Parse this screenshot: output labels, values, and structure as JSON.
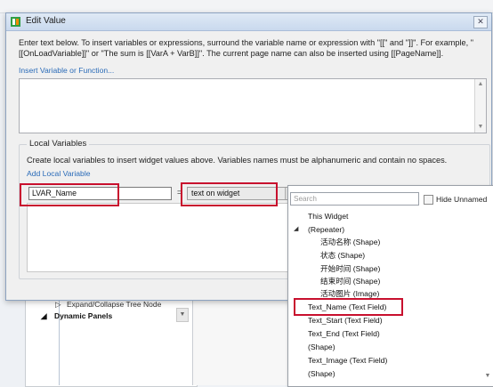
{
  "dialog": {
    "title": "Edit Value",
    "close_symbol": "✕",
    "intro_text": "Enter text below. To insert variables or expressions, surround the variable name or expression with \"[[\" and \"]]\". For example, \"[[OnLoadVariable]]\" or \"The sum is [[VarA + VarB]]\". The current page name can also be inserted using [[PageName]].",
    "insert_link": "Insert Variable or Function...",
    "local_variables": {
      "title": "Local Variables",
      "description": "Create local variables to insert widget values above. Variables names must be alphanumeric and contain no spaces.",
      "add_link": "Add Local Variable",
      "row": {
        "name_value": "LVAR_Name",
        "equals": "=",
        "type_value": "text on widget"
      }
    }
  },
  "popup": {
    "search_placeholder": "Search",
    "hide_unnamed_label": "Hide Unnamed",
    "items": [
      "This Widget",
      "(Repeater)",
      "活动名称 (Shape)",
      "状态 (Shape)",
      "开始时间 (Shape)",
      "结束时间 (Shape)",
      "活动图片 (Image)",
      "Text_Name (Text Field)",
      "Text_Start (Text Field)",
      "Text_End (Text Field)",
      "(Shape)",
      "Text_Image (Text Field)",
      "(Shape)"
    ]
  },
  "background": {
    "tree_items": [
      "Expand/Collapse Tree Node",
      "Dynamic Panels"
    ]
  },
  "colors": {
    "highlight": "#c8102e",
    "link": "#2a6bb8",
    "titlebar": "#c9d9ee"
  },
  "icons": [
    "app-icon",
    "close-icon",
    "scroll-up-icon",
    "scroll-down-icon",
    "dropdown-arrow-icon",
    "tree-collapse-icon"
  ]
}
